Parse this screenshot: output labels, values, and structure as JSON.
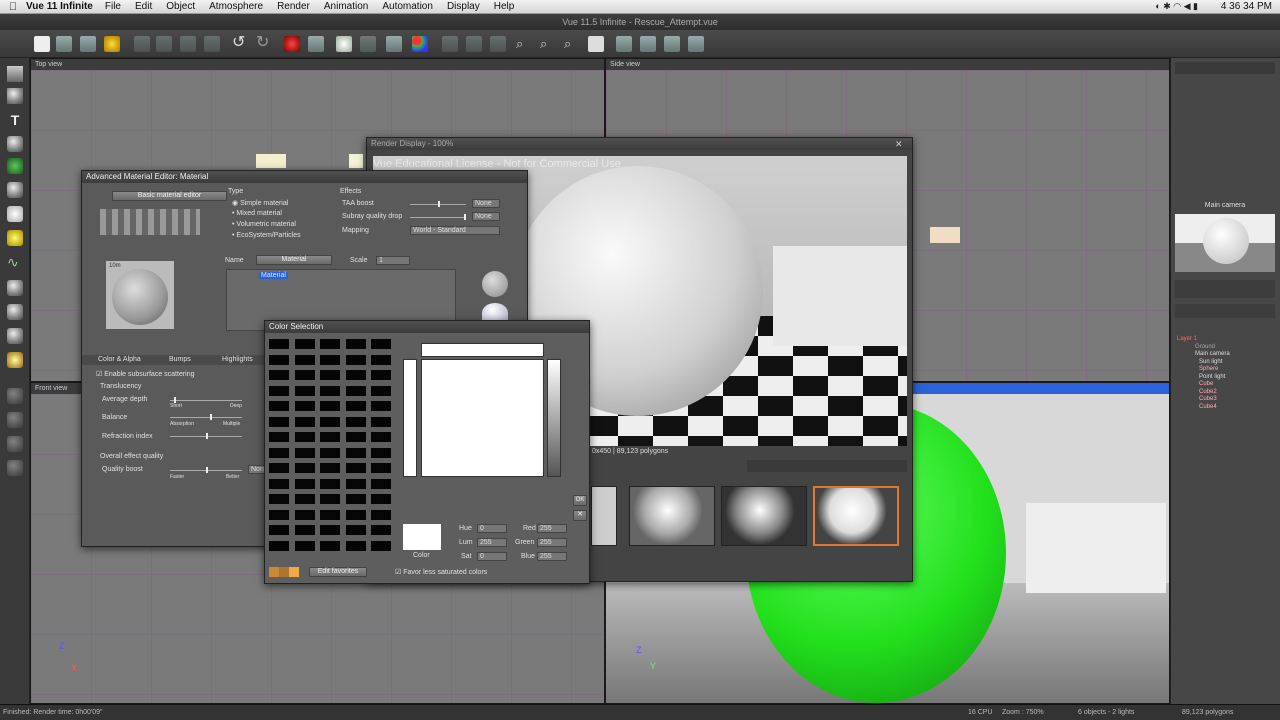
{
  "menubar": {
    "app_name": "Vue 11 Infinite",
    "menus": [
      "File",
      "Edit",
      "Object",
      "Atmosphere",
      "Render",
      "Animation",
      "Automation",
      "Display",
      "Help"
    ],
    "clock": "4 36 34 PM"
  },
  "window": {
    "title": "Vue 11.5 Infinite - Rescue_Attempt.vue"
  },
  "views": {
    "top": "Top view",
    "side": "Side view",
    "front": "Front view",
    "main_camera": "Main camera"
  },
  "render_display": {
    "title": "Render Display - 100%",
    "watermark": "Vue Educational License - Not for Commercial Use",
    "info": "0x450 | 89,123 polygons"
  },
  "material_editor": {
    "title": "Advanced Material Editor: Material",
    "basic_button": "Basic material editor",
    "type_label": "Type",
    "types": [
      "Simple material",
      "Mixed material",
      "Volumetric material",
      "EcoSystem/Particles"
    ],
    "effects_label": "Effects",
    "taa_boost": "TAA boost",
    "taa_value": "None",
    "subray": "Subray quality drop",
    "subray_value": "None",
    "mapping": "Mapping",
    "mapping_value": "World - Standard",
    "name_label": "Name",
    "name_value": "Material",
    "scale_label": "Scale",
    "scale_value": "1",
    "tree_item": "Material",
    "preview_size": "10m",
    "tabs": [
      "Color & Alpha",
      "Bumps",
      "Highlights"
    ],
    "enable_sss": "Enable subsurface scattering",
    "translucency": "Translucency",
    "avg_depth": "Average depth",
    "short": "Short",
    "deep": "Deep",
    "balance": "Balance",
    "absorption": "Absorption",
    "multiple": "Multiple",
    "refraction_index": "Refraction index",
    "overall_quality": "Overall effect quality",
    "quality_boost": "Quality boost",
    "faster": "Faster",
    "better": "Better",
    "none": "None"
  },
  "color_selection": {
    "title": "Color Selection",
    "hue_label": "Hue",
    "hue": "0",
    "lum_label": "Lum",
    "lum": "255",
    "sat_label": "Sat",
    "sat": "0",
    "red_label": "Red",
    "red": "255",
    "green_label": "Green",
    "green": "255",
    "blue_label": "Blue",
    "blue": "255",
    "color_label": "Color",
    "ok": "OK",
    "edit_favorites": "Edit favorites",
    "favor_less": "Favor less saturated colors"
  },
  "world_browser": {
    "tree": [
      "Layer 1",
      "Ground",
      "Main camera",
      "Sun light",
      "Sphere",
      "Point light",
      "Cube",
      "Cube2",
      "Cube3",
      "Cube4"
    ]
  },
  "status": {
    "left": "Finished: Render time: 0h00'09\"",
    "cpu": "16 CPU",
    "zoom": "Zoom : 750%",
    "objects": "6 objects - 2 lights",
    "polygons": "89,123 polygons"
  },
  "colors": {
    "accent": "#2a63d8",
    "sphere_green": "#22e01c",
    "selected_orange": "#e07a2a"
  }
}
